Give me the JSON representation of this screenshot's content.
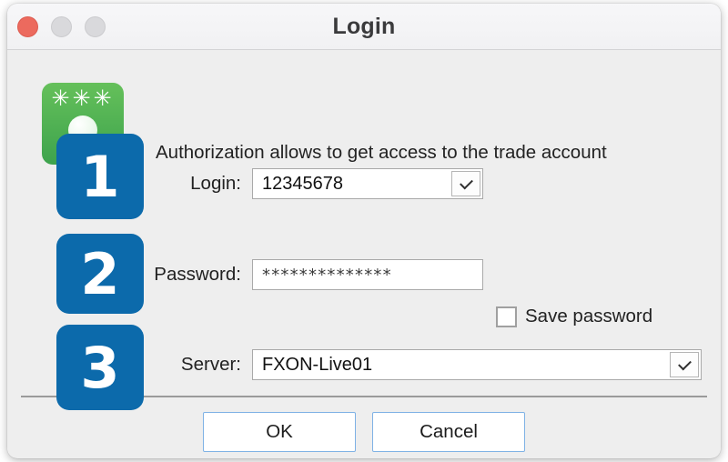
{
  "window": {
    "title": "Login",
    "controls": [
      {
        "name": "close",
        "icon": "close-traffic-light"
      },
      {
        "name": "minimize",
        "icon": "minimize-traffic-light"
      },
      {
        "name": "maximize",
        "icon": "maximize-traffic-light"
      }
    ]
  },
  "app_icon": {
    "name": "password-key-icon",
    "stars": "✳✳✳"
  },
  "headline": "Authorization allows to get access to the trade account",
  "steps": [
    {
      "number": "1"
    },
    {
      "number": "2"
    },
    {
      "number": "3"
    }
  ],
  "form": {
    "login": {
      "label": "Login:",
      "value": "12345678",
      "placeholder": "",
      "dropdown_icon": "chevron-down-icon"
    },
    "password": {
      "label": "Password:",
      "value": "**************",
      "placeholder": ""
    },
    "save_password": {
      "label": "Save password",
      "checked": false
    },
    "server": {
      "label": "Server:",
      "value": "FXON-Live01",
      "placeholder": "",
      "dropdown_icon": "chevron-down-icon"
    }
  },
  "buttons": {
    "ok": "OK",
    "cancel": "Cancel"
  },
  "colors": {
    "badge_blue": "#0c6aab",
    "icon_green": "#3da34d",
    "button_border": "#7fb2e5",
    "close_light": "#ec6a5e",
    "window_background": "#eeeeee"
  }
}
